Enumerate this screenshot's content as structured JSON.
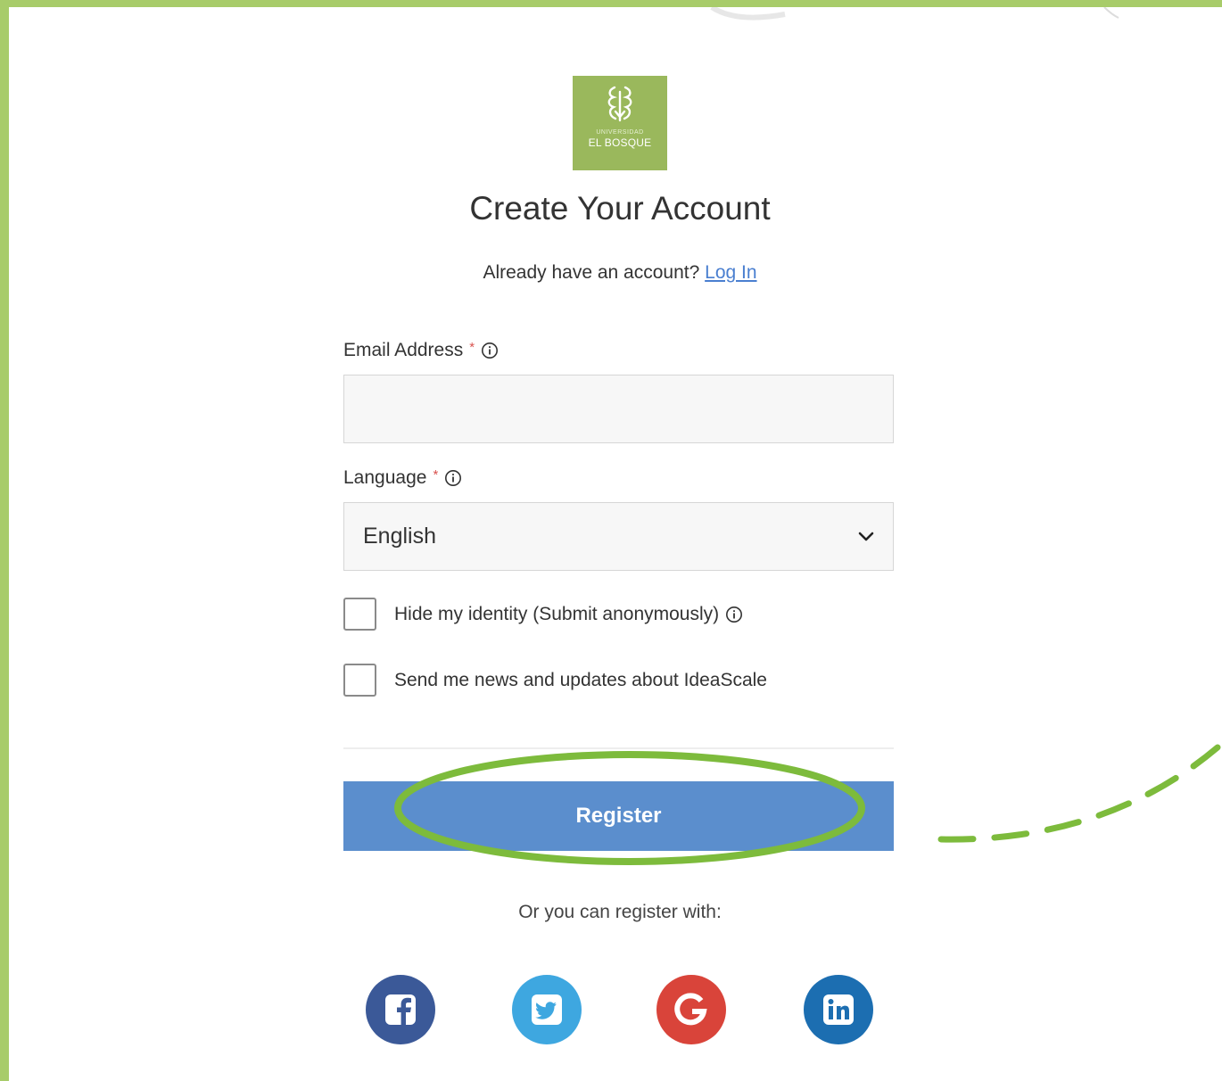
{
  "logo": {
    "line1": "UNIVERSIDAD",
    "line2": "EL BOSQUE"
  },
  "title": "Create Your Account",
  "login_prompt": {
    "text": "Already have an account?",
    "link": "Log In"
  },
  "email": {
    "label": "Email Address",
    "required_mark": "*",
    "value": ""
  },
  "language": {
    "label": "Language",
    "required_mark": "*",
    "selected": "English"
  },
  "options": {
    "anonymous_label": "Hide my identity (Submit anonymously)",
    "anonymous_checked": false,
    "newsletter_label": "Send me news and updates about IdeaScale",
    "newsletter_checked": false
  },
  "register_label": "Register",
  "social": {
    "caption": "Or you can register with:",
    "providers": [
      {
        "icon": "facebook-icon",
        "color": "#3b5998"
      },
      {
        "icon": "twitter-icon",
        "color": "#3ea7e0"
      },
      {
        "icon": "google-icon",
        "color": "#d9443a"
      },
      {
        "icon": "linkedin-icon",
        "color": "#1c6eb1"
      }
    ]
  },
  "colors": {
    "frame": "#a8cc6a",
    "highlight": "#7dbb3c",
    "button": "#5b8ecd",
    "logo_bg": "#9ab85c",
    "link": "#4a7fd0",
    "required": "#d9534f"
  }
}
